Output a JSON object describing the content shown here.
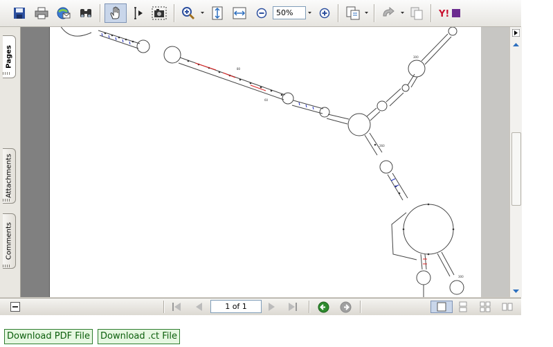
{
  "toolbar": {
    "zoom_value": "50%",
    "icons": [
      "save-icon",
      "print-icon",
      "email-icon",
      "find-icon",
      "hand-tool-icon",
      "select-text-icon",
      "snapshot-icon",
      "zoom-in-tool-icon",
      "fit-page-icon",
      "fit-width-icon",
      "zoom-out-icon",
      "zoom-in-icon",
      "page-layout-icon",
      "rotate-icon",
      "copy-icon",
      "yahoo-icon"
    ]
  },
  "side_panel": {
    "tabs": [
      "Pages",
      "Attachments",
      "Comments"
    ]
  },
  "status_bar": {
    "page_indicator": "1 of 1"
  },
  "buttons": {
    "download_pdf": "Download PDF File",
    "download_ct": "Download .ct File"
  },
  "document": {
    "labels": [
      "80",
      "60",
      "260",
      "260",
      "300",
      "300"
    ]
  },
  "colors": {
    "accent_selected": "#c9d6ea",
    "download_button_bg": "#e6f7e1",
    "download_button_text": "#0b5e0b"
  }
}
